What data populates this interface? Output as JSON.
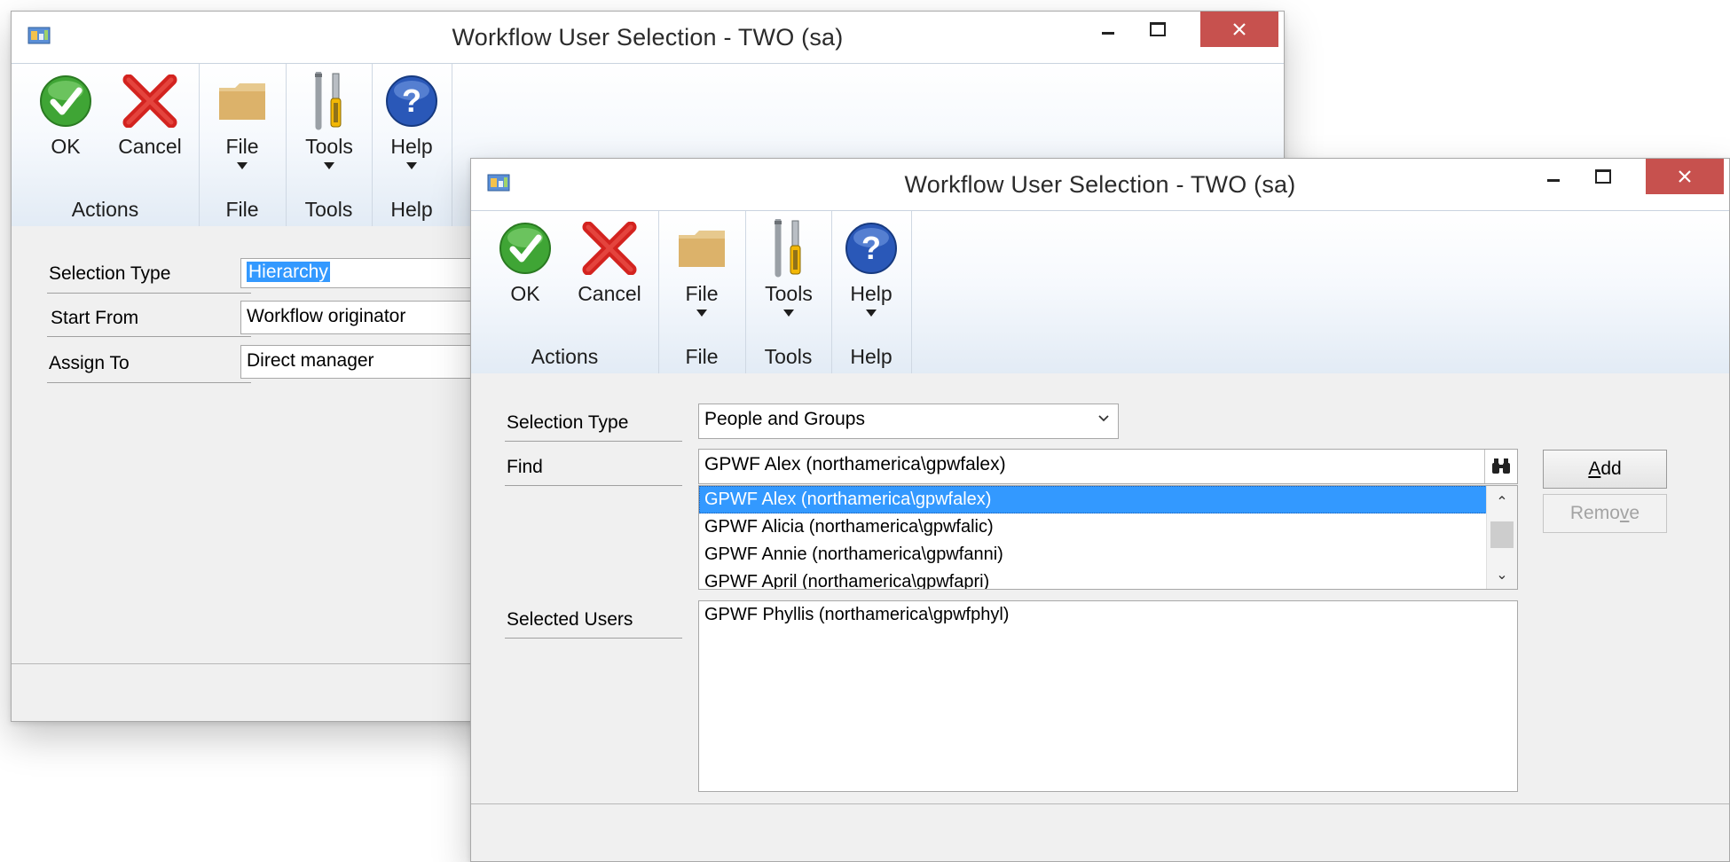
{
  "back_window": {
    "title": "Workflow User Selection  -  TWO (sa)",
    "ribbon": {
      "ok_label": "OK",
      "cancel_label": "Cancel",
      "file_label": "File",
      "tools_label": "Tools",
      "help_label": "Help",
      "groups": {
        "actions": "Actions",
        "file": "File",
        "tools": "Tools",
        "help": "Help"
      }
    },
    "fields": {
      "selection_type_label": "Selection Type",
      "selection_type_value": "Hierarchy",
      "start_from_label": "Start From",
      "start_from_value": "Workflow originator",
      "assign_to_label": "Assign To",
      "assign_to_value": "Direct manager"
    }
  },
  "front_window": {
    "title": "Workflow User Selection  -  TWO (sa)",
    "ribbon": {
      "ok_label": "OK",
      "cancel_label": "Cancel",
      "file_label": "File",
      "tools_label": "Tools",
      "help_label": "Help",
      "groups": {
        "actions": "Actions",
        "file": "File",
        "tools": "Tools",
        "help": "Help"
      }
    },
    "fields": {
      "selection_type_label": "Selection Type",
      "selection_type_value": "People and Groups",
      "find_label": "Find",
      "find_value": "GPWF Alex (northamerica\\gpwfalex)",
      "selected_users_label": "Selected Users"
    },
    "find_results": [
      "GPWF Alex (northamerica\\gpwfalex)",
      "GPWF Alicia (northamerica\\gpwfalic)",
      "GPWF Annie (northamerica\\gpwfanni)",
      "GPWF April (northamerica\\gpwfapri)"
    ],
    "selected_users": [
      "GPWF Phyllis (northamerica\\gpwfphyl)"
    ],
    "buttons": {
      "add_accel": "A",
      "add_rest": "dd",
      "remove_pre": "Remo",
      "remove_accel": "v",
      "remove_post": "e"
    }
  },
  "colors": {
    "selection": "#3399ff",
    "close_button": "#c7514e",
    "ribbon_border": "#b7c3d2"
  },
  "icons": [
    "app-icon",
    "ok-check-icon",
    "cancel-x-icon",
    "folder-icon",
    "tools-icon",
    "help-icon",
    "binoculars-icon",
    "dropdown-arrow-icon",
    "scroll-up-icon",
    "scroll-down-icon"
  ]
}
